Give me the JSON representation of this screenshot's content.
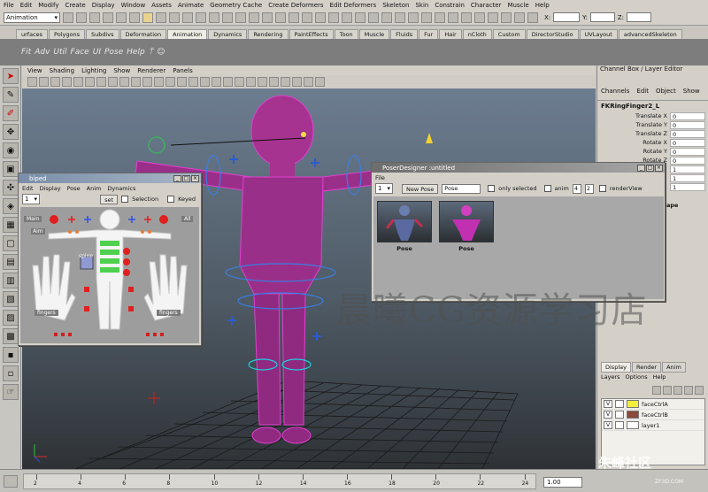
{
  "menubar": [
    "File",
    "Edit",
    "Modify",
    "Create",
    "Display",
    "Window",
    "Assets",
    "Animate",
    "Geometry Cache",
    "Create Deformers",
    "Edit Deformers",
    "Skeleton",
    "Skin",
    "Constrain",
    "Character",
    "Muscle",
    "Help"
  ],
  "statusline": {
    "mode": "Animation",
    "x_label": "X:",
    "y_label": "Y:",
    "z_label": "Z:"
  },
  "shelf_tabs": [
    "urfaces",
    "Polygons",
    "Subdivs",
    "Deformation",
    "Animation",
    "Dynamics",
    "Rendering",
    "PaintEffects",
    "Toon",
    "Muscle",
    "Fluids",
    "Fur",
    "Hair",
    "nCloth",
    "Custom",
    "DirectorStudio",
    "UVLayout",
    "advancedSkeleton"
  ],
  "shelf_items": [
    "Fit",
    "Adv",
    "Util",
    "Face",
    "UI",
    "Pose",
    "Help"
  ],
  "viewport_menu": [
    "View",
    "Shading",
    "Lighting",
    "Show",
    "Renderer",
    "Panels"
  ],
  "channel_box": {
    "title": "Channel Box / Layer Editor",
    "menu": [
      "Channels",
      "Edit",
      "Object",
      "Show"
    ],
    "node": "FKRingFinger2_L",
    "attrs": [
      {
        "name": "Translate X",
        "value": "0"
      },
      {
        "name": "Translate Y",
        "value": "0"
      },
      {
        "name": "Translate Z",
        "value": "0"
      },
      {
        "name": "Rotate X",
        "value": "0"
      },
      {
        "name": "Rotate Y",
        "value": "0"
      },
      {
        "name": "Rotate Z",
        "value": "0"
      },
      {
        "name": "",
        "value": "1"
      },
      {
        "name": "",
        "value": "1"
      },
      {
        "name": "",
        "value": "1"
      }
    ],
    "shape_label": "ape",
    "layer_tabs": [
      "Display",
      "Render",
      "Anim"
    ],
    "layer_menu": [
      "Layers",
      "Options",
      "Help"
    ],
    "layers": [
      {
        "v": "V",
        "name": "faceCtrlA",
        "color": "#f2f03a"
      },
      {
        "v": "V",
        "name": "faceCtrlB",
        "color": "#8b4a3a"
      },
      {
        "v": "V",
        "name": "layer1",
        "color": "#ffffff"
      }
    ]
  },
  "biped": {
    "title": "biped",
    "menu": [
      "Edit",
      "Display",
      "Pose",
      "Anim",
      "Dynamics"
    ],
    "num": "1",
    "set_label": "set",
    "selection_label": "Selection",
    "keyed_label": "Keyed",
    "labels": {
      "main": "Main",
      "all": "All",
      "aim": "Aim",
      "spine": "spine",
      "fingers_l": "fingers",
      "fingers_r": "fingers"
    }
  },
  "poser": {
    "title": "PoserDesigner :untitled",
    "menu": [
      "File"
    ],
    "num": "1",
    "new_pose": "New Pose",
    "pose_field": "Pose",
    "only_selected": "only selected",
    "anim_label": "anim",
    "anim_a": "4",
    "anim_b": "2",
    "render_view": "renderView",
    "poses": [
      "Pose",
      "Pose"
    ]
  },
  "timeline": {
    "ticks": [
      "2",
      "4",
      "6",
      "8",
      "10",
      "12",
      "14",
      "16",
      "18",
      "20",
      "22",
      "24"
    ],
    "current": "1.00"
  },
  "watermark": "晨曦CG资源学习店",
  "watermark2": "朱峰社区",
  "watermark3": "ZF3D.COM"
}
